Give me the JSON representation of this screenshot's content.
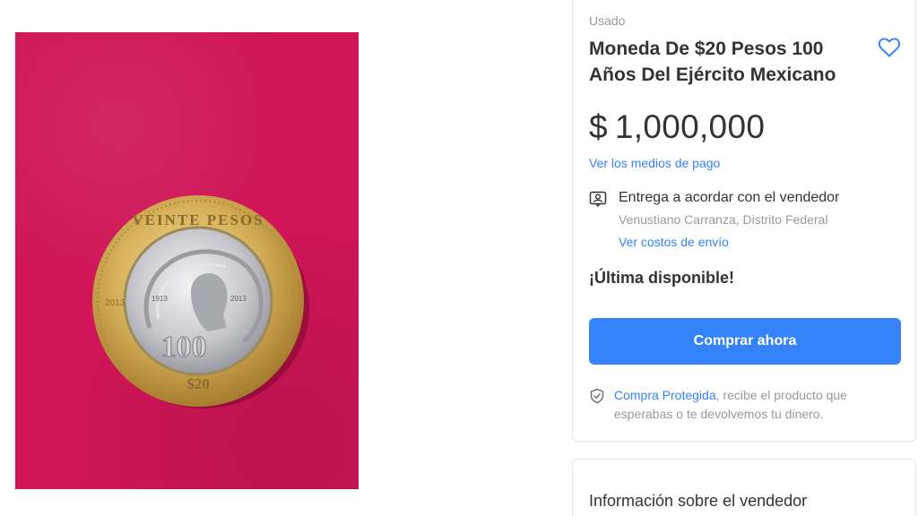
{
  "product": {
    "condition": "Usado",
    "title": "Moneda De $20 Pesos 100 Años Del Ejército Mexicano",
    "price_currency": "$",
    "price_amount": "1,000,000",
    "payment_link": "Ver los medios de pago",
    "delivery": {
      "title": "Entrega a acordar con el vendedor",
      "location": "Venustiano Carranza, Distrito Federal",
      "shipping_link": "Ver costos de envío"
    },
    "stock": "¡Última disponible!",
    "buy_label": "Comprar ahora",
    "protection": {
      "link": "Compra Protegida",
      "text": ", recibe el producto que esperabas o te devolvemos tu dinero."
    }
  },
  "seller": {
    "section_title": "Información sobre el vendedor"
  },
  "coin": {
    "top_text": "VEINTE PESOS",
    "center_text": "100",
    "denomination": "$20",
    "year_left": "2013",
    "year_1": "1913",
    "year_2": "2013"
  },
  "colors": {
    "accent": "#3483fa",
    "background_photo": "#cf1556",
    "text_primary": "#333333",
    "text_secondary": "#999999"
  },
  "icons": {
    "favorite": "heart-outline-icon",
    "delivery": "person-card-icon",
    "protection": "shield-check-icon"
  }
}
